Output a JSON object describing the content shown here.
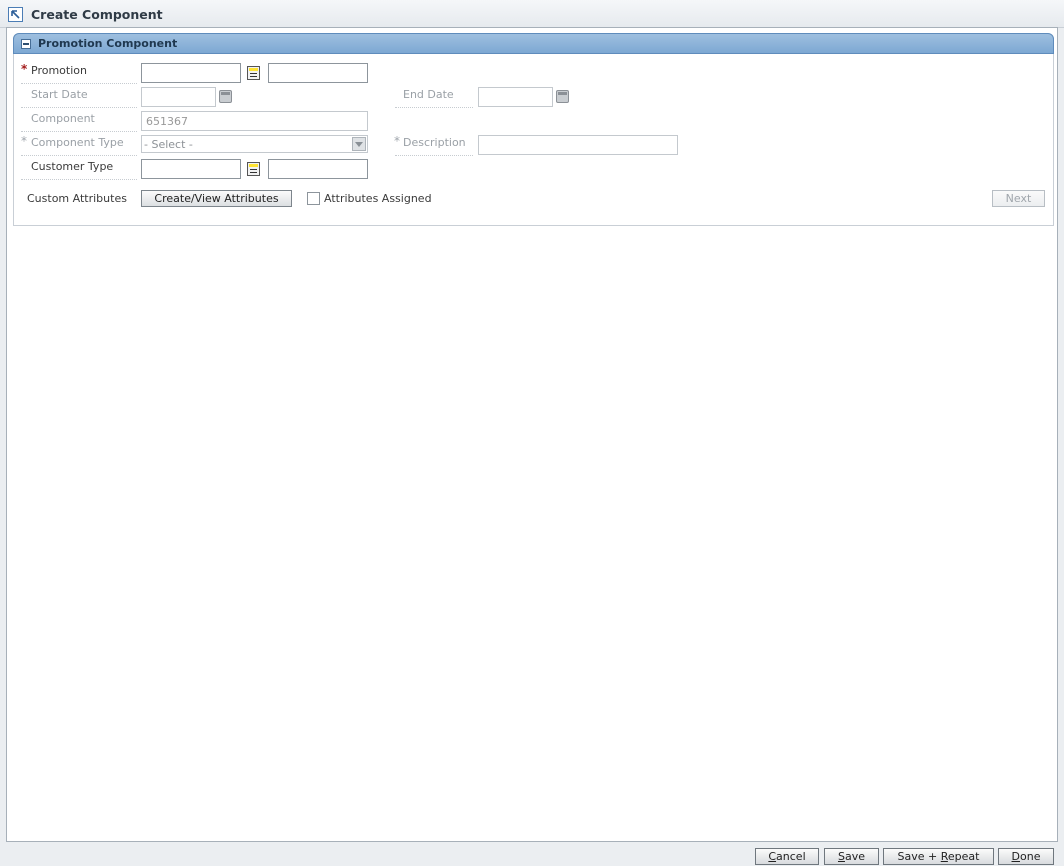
{
  "window": {
    "title": "Create Component",
    "icon": "arrow-up-left-icon"
  },
  "panel": {
    "title": "Promotion Component",
    "collapse_icon": "collapse-minus-icon"
  },
  "form": {
    "promotion": {
      "label": "Promotion",
      "required": "*",
      "value": "",
      "desc_value": ""
    },
    "start_date": {
      "label": "Start Date",
      "value": ""
    },
    "end_date": {
      "label": "End Date",
      "value": ""
    },
    "component": {
      "label": "Component",
      "value": "651367"
    },
    "component_type": {
      "label": "Component Type",
      "required": "*",
      "selected": "- Select -"
    },
    "description": {
      "label": "Description",
      "required": "*",
      "value": ""
    },
    "customer_type": {
      "label": "Customer Type",
      "value": "",
      "desc_value": ""
    },
    "custom_attributes": {
      "label": "Custom Attributes",
      "button": "Create/View Attributes",
      "checkbox_label": "Attributes Assigned",
      "checked": false
    },
    "next_button": "Next"
  },
  "footer": {
    "cancel": {
      "mnemonic": "C",
      "rest": "ancel"
    },
    "save": {
      "mnemonic": "S",
      "rest": "ave"
    },
    "save_repeat": {
      "prefix": "Save + ",
      "mnemonic": "R",
      "rest": "epeat"
    },
    "done": {
      "mnemonic": "D",
      "rest": "one"
    }
  }
}
